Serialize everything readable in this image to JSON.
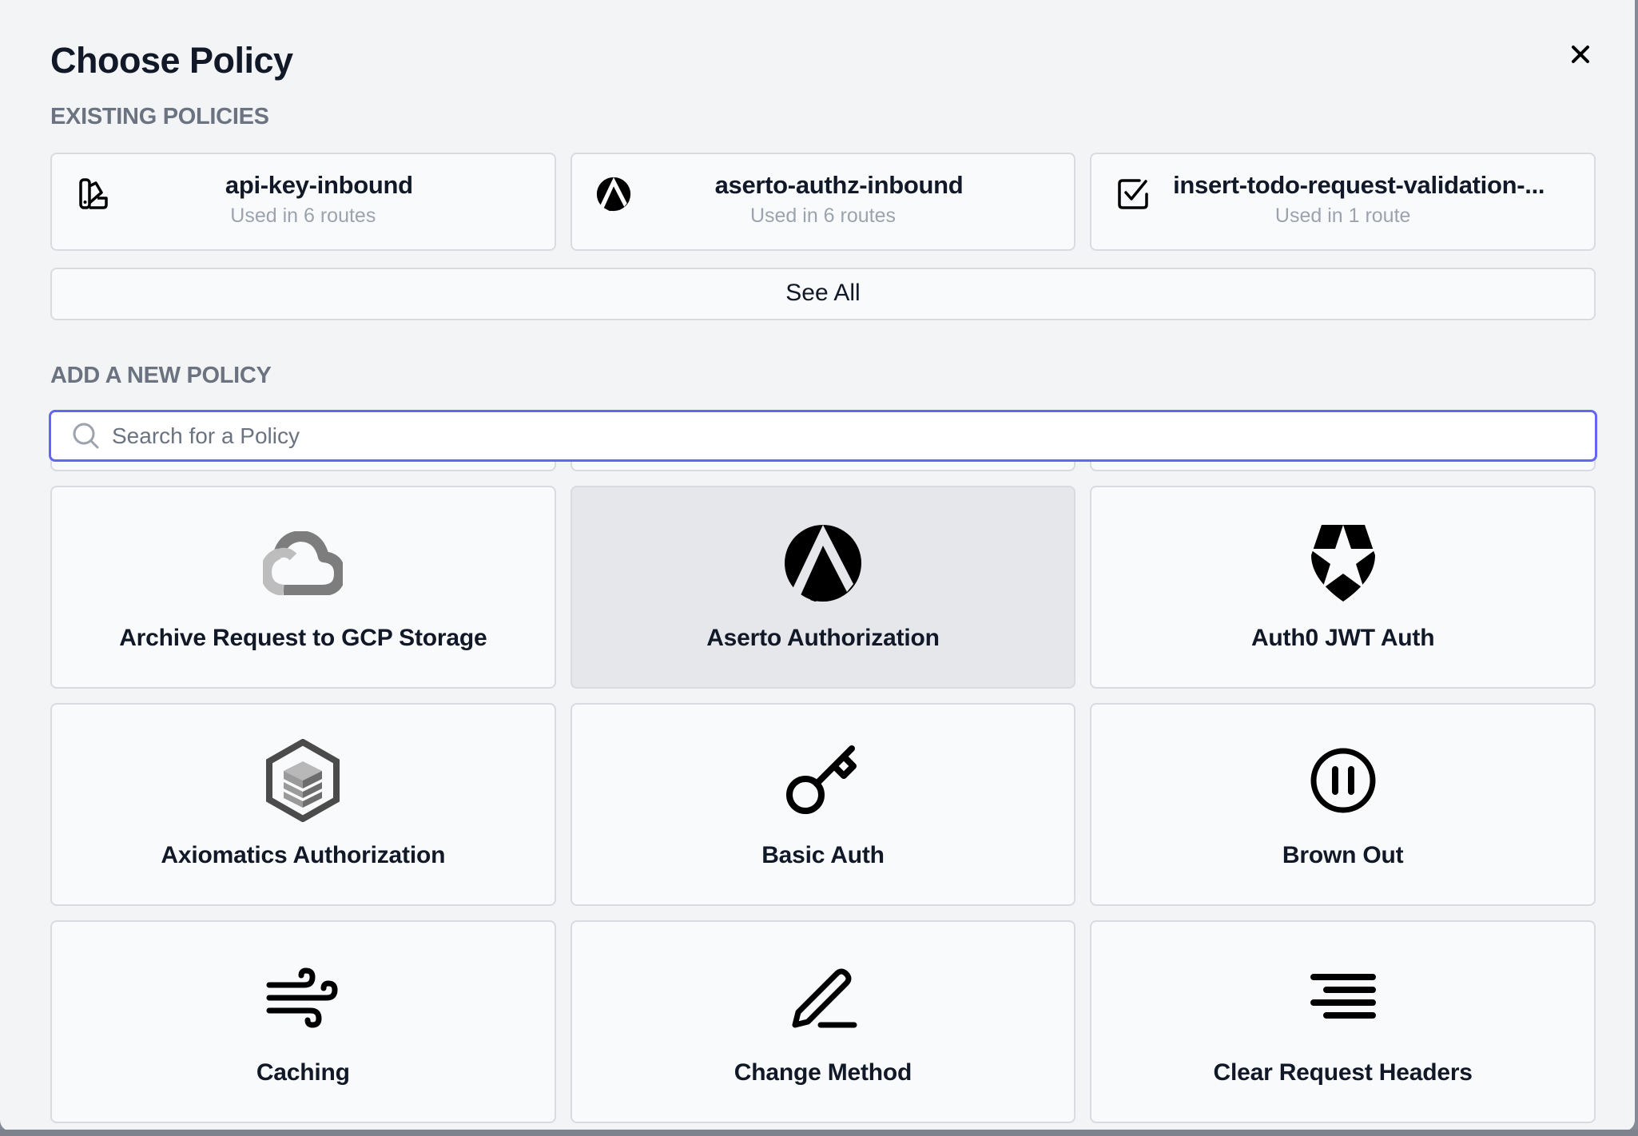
{
  "dialog": {
    "title": "Choose Policy",
    "close_icon": "close-icon"
  },
  "existing": {
    "section_label": "EXISTING POLICIES",
    "policies": [
      {
        "name": "api-key-inbound",
        "usage": "Used in 6 routes",
        "icon": "swatch-icon"
      },
      {
        "name": "aserto-authz-inbound",
        "usage": "Used in 6 routes",
        "icon": "aserto-logo-icon"
      },
      {
        "name": "insert-todo-request-validation-...",
        "usage": "Used in 1 route",
        "icon": "checkbox-icon"
      }
    ],
    "see_all_label": "See All"
  },
  "add_new": {
    "section_label": "ADD A NEW POLICY",
    "search": {
      "value": "",
      "placeholder": "Search for a Policy",
      "icon": "search-icon"
    },
    "policies": [
      {
        "label": "",
        "icon": ""
      },
      {
        "label": "",
        "icon": ""
      },
      {
        "label": "",
        "icon": ""
      },
      {
        "label": "Archive Request to GCP Storage",
        "icon": "gcp-cloud-icon"
      },
      {
        "label": "Aserto Authorization",
        "icon": "aserto-logo-icon",
        "hovered": true
      },
      {
        "label": "Auth0 JWT Auth",
        "icon": "auth0-shield-icon"
      },
      {
        "label": "Axiomatics Authorization",
        "icon": "axiomatics-cube-icon"
      },
      {
        "label": "Basic Auth",
        "icon": "key-icon"
      },
      {
        "label": "Brown Out",
        "icon": "pause-circle-icon"
      },
      {
        "label": "Caching",
        "icon": "wind-icon"
      },
      {
        "label": "Change Method",
        "icon": "pencil-icon"
      },
      {
        "label": "Clear Request Headers",
        "icon": "align-right-lines-icon"
      }
    ]
  },
  "colors": {
    "accent": "#6366f1",
    "text_primary": "#111827",
    "text_muted": "#6b7280",
    "card_bg": "#f9fafb",
    "card_hover_bg": "#e5e7eb",
    "modal_bg": "#f3f4f6"
  }
}
